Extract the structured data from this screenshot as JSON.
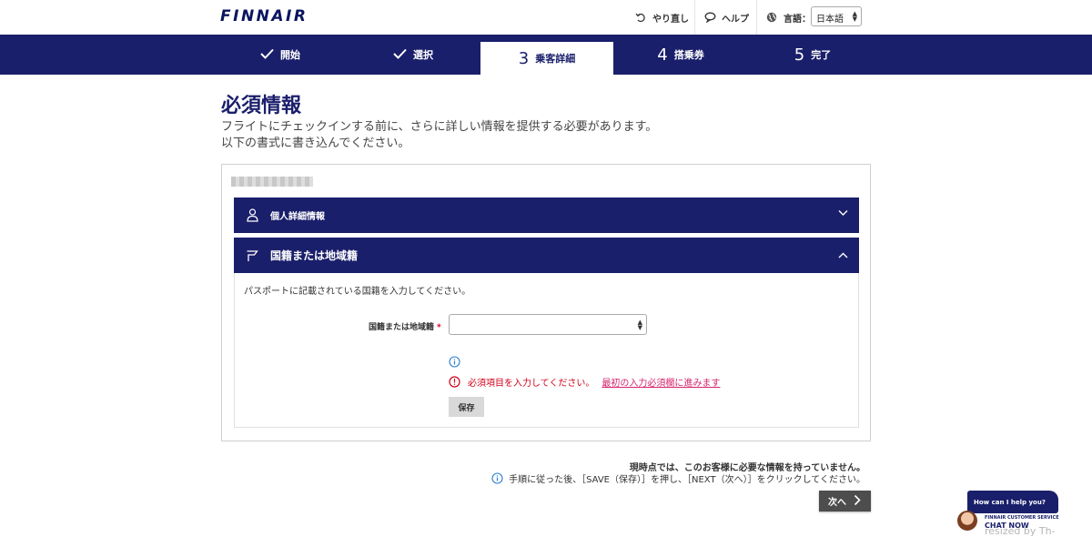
{
  "brand": {
    "logo_text": "FINNAIR",
    "color_primary": "#1a1f6b",
    "color_error": "#d0021b",
    "color_link": "#d6246e"
  },
  "header": {
    "undo_label": "やり直し",
    "help_label": "ヘルプ",
    "language_label": "言語：",
    "language_value": "日本語",
    "icons": {
      "undo": "undo-icon",
      "help": "chat-bubble-icon",
      "language": "globe-icon"
    }
  },
  "steps": [
    {
      "number": "",
      "label": "開始",
      "state": "done",
      "icon": "check-icon"
    },
    {
      "number": "",
      "label": "選択",
      "state": "done",
      "icon": "check-icon"
    },
    {
      "number": "3",
      "label": "乗客詳細",
      "state": "active"
    },
    {
      "number": "4",
      "label": "搭乗券",
      "state": "pending"
    },
    {
      "number": "5",
      "label": "完了",
      "state": "pending"
    }
  ],
  "main": {
    "title": "必須情報",
    "intro_line1": "フライトにチェックインする前に、さらに詳しい情報を提供する必要があります。",
    "intro_line2": "以下の書式に書き込んでください。"
  },
  "panels": {
    "personal": {
      "title": "個人詳細情報",
      "icon": "person-icon",
      "expanded": false
    },
    "nationality": {
      "title": "国籍または地域籍",
      "icon": "flag-icon",
      "expanded": true,
      "description": "パスポートに記載されている国籍を入力してください。",
      "field_label": "国籍または地域籍",
      "required_mark": "*",
      "field_value": "",
      "error_text": "必須項目を入力してください。",
      "error_link": "最初の入力必須欄に進みます",
      "save_label": "保存"
    }
  },
  "footer": {
    "notice_bold": "現時点では、このお客様に必要な情報を持っていません。",
    "notice_info": "手順に従った後、［SAVE（保存）］を押し、［NEXT（次へ）］をクリックしてください。",
    "next_label": "次へ"
  },
  "chat": {
    "bubble_text": "How can I help you?",
    "service_text": "FINNAIR CUSTOMER SERVICE",
    "cta_text": "CHAT NOW"
  },
  "watermark": "resized by Th-MakerX"
}
